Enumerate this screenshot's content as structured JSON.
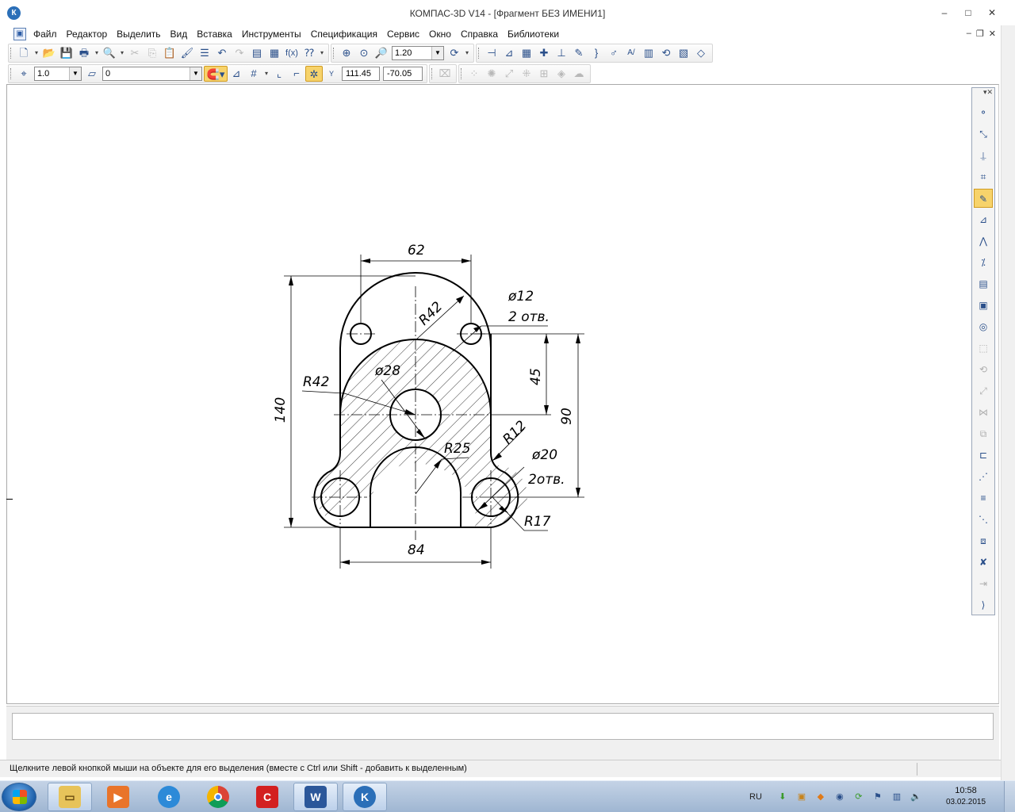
{
  "window": {
    "title": "КОМПАС-3D V14 - [Фрагмент БЕЗ ИМЕНИ1]",
    "app_logo": "К",
    "controls": [
      "–",
      "□",
      "✕"
    ]
  },
  "menu": {
    "items": [
      "Файл",
      "Редактор",
      "Выделить",
      "Вид",
      "Вставка",
      "Инструменты",
      "Спецификация",
      "Сервис",
      "Окно",
      "Справка",
      "Библиотеки"
    ],
    "mdi_controls": [
      "–",
      "❐",
      "✕"
    ]
  },
  "toolbar_standard": {
    "zoom_value": "1.20",
    "icons": [
      "new-file-icon",
      "open-file-icon",
      "save-icon",
      "print-icon",
      "preview-icon",
      "cut-icon",
      "copy-icon",
      "paste-icon",
      "properties-icon",
      "undo-icon",
      "redo-icon",
      "manager-icon",
      "library-icon",
      "variables-icon",
      "help-icon",
      "zoom-window-icon",
      "zoom-fit-icon",
      "zoom-in-icon",
      "refresh-icon"
    ]
  },
  "toolbar_current_state": {
    "step_value": "1.0",
    "layer_value": "0",
    "coord_x": "111.45",
    "coord_y": "-70.05"
  },
  "drawing": {
    "dim_top": "62",
    "dim_bottom": "84",
    "dim_left": "140",
    "dim_right_45": "45",
    "dim_right_90": "90",
    "radius_outer": "R42",
    "radius_inner": "R42",
    "diameter_center": "ø28",
    "radius_arch": "R25",
    "radius_r12": "R12",
    "radius_r17": "R17",
    "hole_small_dia": "ø12",
    "hole_small_count": "2 отв.",
    "hole_large_dia": "ø20",
    "hole_large_count": "2отв."
  },
  "status": {
    "message": "Щелкните левой кнопкой мыши на объекте для его выделения (вместе с Ctrl или Shift - добавить к выделенным)"
  },
  "taskbar": {
    "apps": [
      "explorer-icon",
      "media-player-icon",
      "internet-explorer-icon",
      "chrome-icon",
      "app-red-icon",
      "word-icon",
      "kompas-icon"
    ],
    "language": "RU",
    "time": "10:58",
    "date": "03.02.2015"
  }
}
